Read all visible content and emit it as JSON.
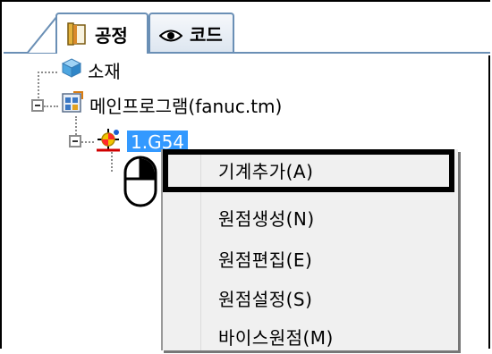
{
  "tabs": [
    {
      "label": "공정",
      "icon": "document-icon",
      "active": true
    },
    {
      "label": "코드",
      "icon": "eye-icon",
      "active": false
    }
  ],
  "tree": {
    "material": {
      "label": "소재",
      "icon": "cube-icon"
    },
    "main_program": {
      "label": "메인프로그램(fanuc.tm)",
      "icon": "program-icon"
    },
    "work_offset": {
      "label": "1.G54",
      "icon": "origin-icon",
      "selected": true
    }
  },
  "context_menu": {
    "items": [
      {
        "label": "기계추가(A)",
        "highlighted": true
      },
      {
        "label": "원점생성(N)"
      },
      {
        "label": "원점편집(E)"
      },
      {
        "label": "원점설정(S)"
      },
      {
        "label": "바이스원점(M)"
      }
    ]
  },
  "colors": {
    "selection": "#3399ff",
    "tab_border": "#6a8fb5"
  }
}
